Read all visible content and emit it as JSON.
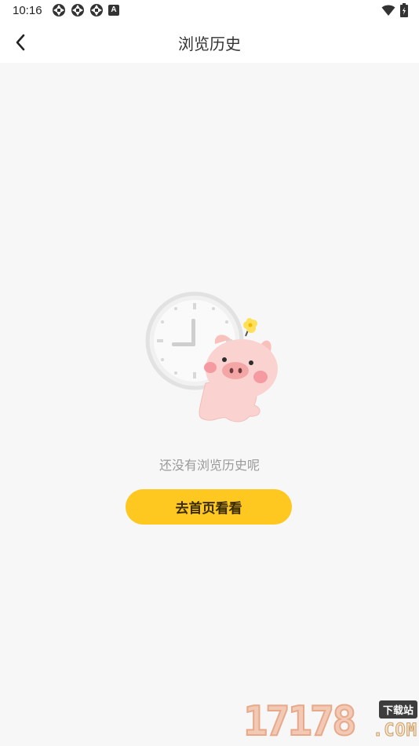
{
  "status_bar": {
    "time": "10:16",
    "left_icons": [
      "aperture-icon",
      "aperture-icon",
      "aperture-icon",
      "a-badge-icon"
    ],
    "right_icons": [
      "wifi-icon",
      "battery-icon"
    ],
    "a_badge": "A"
  },
  "header": {
    "title": "浏览历史",
    "back_icon": "chevron-left-icon"
  },
  "empty_state": {
    "message": "还没有浏览历史呢",
    "button_label": "去首页看看",
    "illustration": "clock-and-pig-icon"
  },
  "watermark": {
    "number": "17178",
    "tag": "下载站",
    "domain": ".COM"
  },
  "colors": {
    "accent": "#ffc821",
    "background": "#f7f7f7",
    "pig": "#f9c7c4",
    "muted_text": "#9a9a9a"
  }
}
